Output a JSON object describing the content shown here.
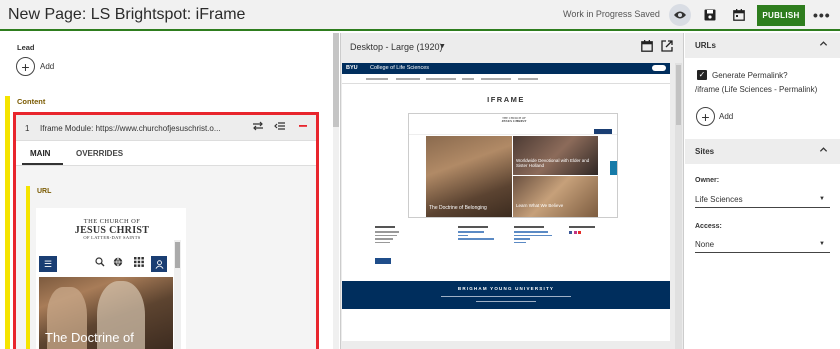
{
  "header": {
    "title": "New Page: LS Brightspot: iFrame",
    "status": "Work in Progress Saved",
    "publish_label": "PUBLISH",
    "more_label": "•••",
    "accent_color": "#2e7d1e"
  },
  "left": {
    "lead_label": "Lead",
    "lead_add": "Add",
    "content_label": "Content",
    "module": {
      "number": "1",
      "title": "Iframe Module: https://www.churchofjesuschrist.o...",
      "tabs": [
        "MAIN",
        "OVERRIDES"
      ],
      "active_tab": "MAIN",
      "url_label": "URL",
      "preview": {
        "logo_line1": "THE CHURCH OF",
        "logo_line2": "JESUS CHRIST",
        "logo_line3": "OF LATTER-DAY SAINTS",
        "hero_text": "The Doctrine of"
      }
    }
  },
  "middle": {
    "device": "Desktop - Large (1920)",
    "preview": {
      "logo": "BYU",
      "college": "College of Life Sciences",
      "section_title": "IFRAME",
      "embed_captions": [
        "The Doctrine of Belonging",
        "Worldwide Devotional with Elder and Sister Holland",
        "Learn What We Believe"
      ],
      "footer_title": "BRIGHAM YOUNG UNIVERSITY"
    }
  },
  "right": {
    "urls_title": "URLs",
    "generate_permalink": "Generate Permalink?",
    "permalink_value": "/iframe (Life Sciences - Permalink)",
    "add_label": "Add",
    "sites_title": "Sites",
    "owner_label": "Owner:",
    "owner_value": "Life Sciences",
    "access_label": "Access:",
    "access_value": "None"
  }
}
